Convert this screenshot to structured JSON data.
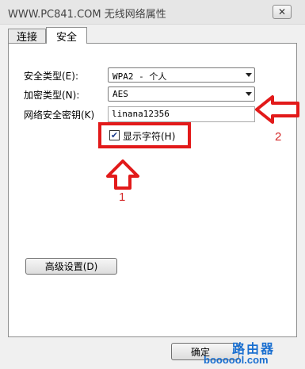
{
  "window": {
    "title": "WWW.PC841.COM 无线网络属性",
    "close_glyph": "✕"
  },
  "tabs": [
    {
      "label": "连接",
      "active": false
    },
    {
      "label": "安全",
      "active": true
    }
  ],
  "security": {
    "security_type_label": "安全类型(E):",
    "security_type_value": "WPA2 - 个人",
    "encryption_type_label": "加密类型(N):",
    "encryption_type_value": "AES",
    "key_label": "网络安全密钥(K)",
    "key_value": "linana12356",
    "show_chars_label": "显示字符(H)",
    "show_chars_checked": true,
    "check_glyph": "✔"
  },
  "annotations": {
    "arrow_up_number": "1",
    "arrow_left_number": "2",
    "color": "#e21a1a"
  },
  "buttons": {
    "advanced_label": "高级设置(D)",
    "ok_label": "确定"
  },
  "watermark": {
    "line1": "路由器",
    "line2": "boooool.com"
  }
}
